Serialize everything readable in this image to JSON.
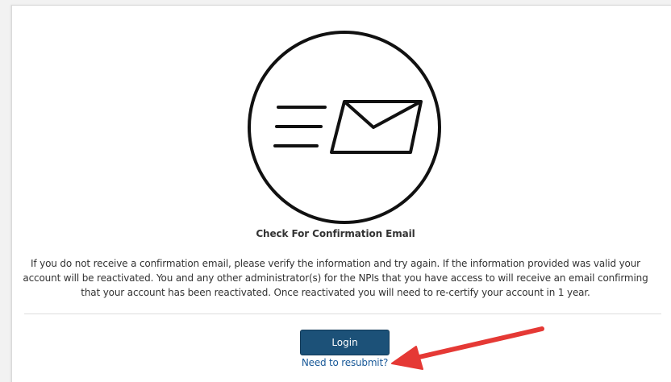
{
  "confirmation": {
    "icon": "envelope-sending-icon",
    "heading": "Check For Confirmation Email",
    "message_line1": "If you do not receive a confirmation email, please verify the information and try again. If the information provided was valid your",
    "message_line2": "account will be reactivated. You and any other administrator(s) for the NPIs that you have access to will receive an email confirming",
    "message_line3": "that your account has been reactivated. Once reactivated you will need to re-certify your account in 1 year."
  },
  "actions": {
    "login_label": "Login",
    "resubmit_link": "Need to resubmit?"
  },
  "colors": {
    "button_bg": "#1c5178",
    "link": "#1a5a99",
    "annotation_arrow": "#e53935"
  }
}
